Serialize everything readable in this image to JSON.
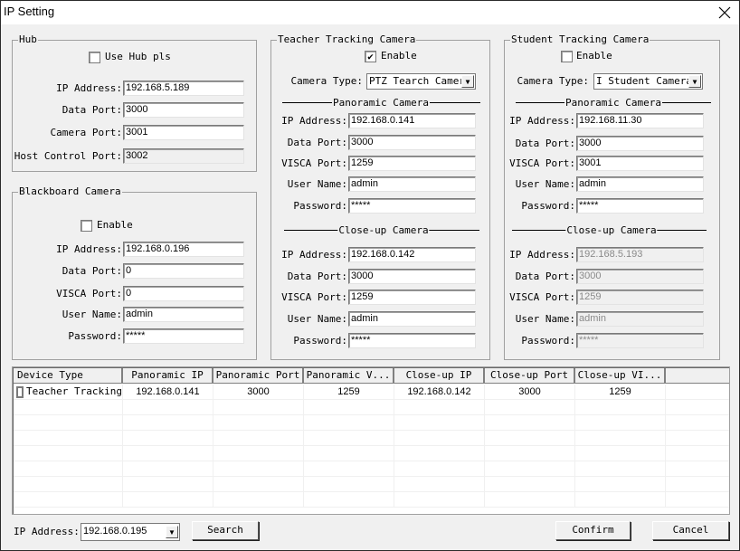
{
  "window": {
    "title": "IP Setting",
    "close_icon": "close-icon"
  },
  "hub": {
    "title": "Hub",
    "use_hub_label": "Use Hub pls",
    "use_hub_checked": false,
    "fields": [
      {
        "label": "IP Address:",
        "value": "192.168.5.189"
      },
      {
        "label": "Data Port:",
        "value": "3000"
      },
      {
        "label": "Camera Port:",
        "value": "3001"
      },
      {
        "label": "Host Control Port:",
        "value": "3002",
        "readonly": true
      }
    ]
  },
  "blackboard": {
    "title": "Blackboard Camera",
    "enable_label": "Enable",
    "enable_checked": false,
    "fields": [
      {
        "label": "IP Address:",
        "value": "192.168.0.196"
      },
      {
        "label": "Data Port:",
        "value": "0"
      },
      {
        "label": "VISCA Port:",
        "value": "0"
      },
      {
        "label": "User Name:",
        "value": "admin"
      },
      {
        "label": "Password:",
        "value": "*****"
      }
    ]
  },
  "teacher": {
    "title": "Teacher Tracking Camera",
    "enable_label": "Enable",
    "enable_checked": true,
    "check_mark": "✔",
    "camera_type_label": "Camera Type:",
    "camera_type_value": "PTZ Tearch Camer:",
    "panoramic_title": "Panoramic Camera",
    "panoramic": [
      {
        "label": "IP Address:",
        "value": "192.168.0.141"
      },
      {
        "label": "Data Port:",
        "value": "3000"
      },
      {
        "label": "VISCA Port:",
        "value": "1259"
      },
      {
        "label": "User Name:",
        "value": "admin"
      },
      {
        "label": "Password:",
        "value": "*****"
      }
    ],
    "closeup_title": "Close-up Camera",
    "closeup": [
      {
        "label": "IP Address:",
        "value": "192.168.0.142"
      },
      {
        "label": "Data Port:",
        "value": "3000"
      },
      {
        "label": "VISCA Port:",
        "value": "1259"
      },
      {
        "label": "User Name:",
        "value": "admin"
      },
      {
        "label": "Password:",
        "value": "*****"
      }
    ]
  },
  "student": {
    "title": "Student Tracking Camera",
    "enable_label": "Enable",
    "enable_checked": false,
    "camera_type_label": "Camera Type:",
    "camera_type_value": "I Student Camera",
    "panoramic_title": "Panoramic Camera",
    "panoramic": [
      {
        "label": "IP Address:",
        "value": "192.168.11.30"
      },
      {
        "label": "Data Port:",
        "value": "3000"
      },
      {
        "label": "VISCA Port:",
        "value": "3001"
      },
      {
        "label": "User Name:",
        "value": "admin"
      },
      {
        "label": "Password:",
        "value": "*****"
      }
    ],
    "closeup_title": "Close-up Camera",
    "closeup_disabled": true,
    "closeup": [
      {
        "label": "IP Address:",
        "value": "192.168.5.193"
      },
      {
        "label": "Data Port:",
        "value": "3000"
      },
      {
        "label": "VISCA Port:",
        "value": "1259"
      },
      {
        "label": "User Name:",
        "value": "admin"
      },
      {
        "label": "Password:",
        "value": "*****"
      }
    ]
  },
  "table": {
    "columns": [
      "Device Type",
      "Panoramic IP",
      "Panoramic Port",
      "Panoramic V...",
      "Close-up IP",
      "Close-up Port",
      "Close-up VI..."
    ],
    "rows": [
      {
        "checked": false,
        "cells": [
          "Teacher Tracking",
          "192.168.0.141",
          "3000",
          "1259",
          "192.168.0.142",
          "3000",
          "1259"
        ]
      }
    ]
  },
  "footer": {
    "ip_label": "IP Address:",
    "ip_value": "192.168.0.195",
    "search_label": "Search",
    "confirm_label": "Confirm",
    "cancel_label": "Cancel"
  },
  "icons": {
    "dropdown": "▼"
  }
}
